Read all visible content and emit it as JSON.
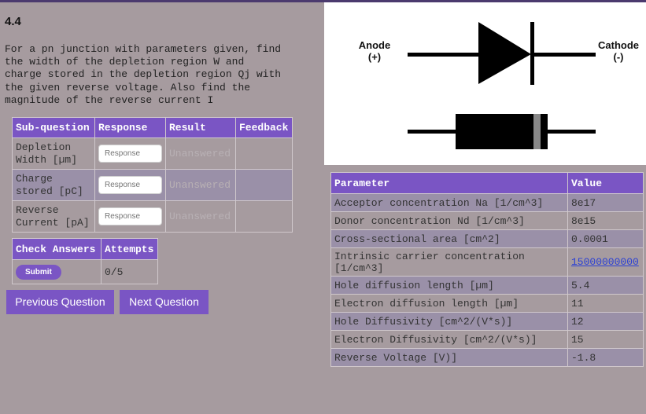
{
  "question": {
    "number": "4.4",
    "text": "For a pn junction with parameters given, find\nthe width of the depletion region W and\ncharge stored in the depletion region Qj with\nthe given reverse voltage. Also find the\nmagnitude of the reverse current I"
  },
  "subquestions": {
    "headers": [
      "Sub-question",
      "Response",
      "Result",
      "Feedback"
    ],
    "rows": [
      {
        "label": "Depletion Width [µm]",
        "placeholder": "Response",
        "result": "Unanswered",
        "feedback": ""
      },
      {
        "label": "Charge stored [pC]",
        "placeholder": "Response",
        "result": "Unanswered",
        "feedback": ""
      },
      {
        "label": "Reverse Current [pA]",
        "placeholder": "Response",
        "result": "Unanswered",
        "feedback": ""
      }
    ]
  },
  "check": {
    "headers": [
      "Check Answers",
      "Attempts"
    ],
    "submit_label": "Submit",
    "attempts": "0/5"
  },
  "nav": {
    "previous_label": "Previous Question",
    "next_label": "Next Question"
  },
  "diagram": {
    "anode_label": "Anode",
    "anode_sign": "(+)",
    "cathode_label": "Cathode",
    "cathode_sign": "(-)"
  },
  "parameters": {
    "headers": [
      "Parameter",
      "Value"
    ],
    "rows": [
      {
        "name": "Acceptor concentration Na [1/cm^3]",
        "value": "8e17"
      },
      {
        "name": "Donor concentration Nd [1/cm^3]",
        "value": "8e15"
      },
      {
        "name": "Cross-sectional area [cm^2]",
        "value": "0.0001"
      },
      {
        "name": "Intrinsic carrier concentration [1/cm^3]",
        "value": "15000000000"
      },
      {
        "name": "Hole diffusion length [µm]",
        "value": "5.4"
      },
      {
        "name": "Electron diffusion length [µm]",
        "value": "11"
      },
      {
        "name": "Hole Diffusivity [cm^2/(V*s)]",
        "value": "12"
      },
      {
        "name": "Electron Diffusivity [cm^2/(V*s)]",
        "value": "15"
      },
      {
        "name": "Reverse Voltage [V)]",
        "value": "-1.8"
      }
    ]
  },
  "colors": {
    "accent": "#7a55c4",
    "background": "#a69b9f",
    "alt_row": "#9a90a8",
    "link": "#2a3fd4"
  }
}
